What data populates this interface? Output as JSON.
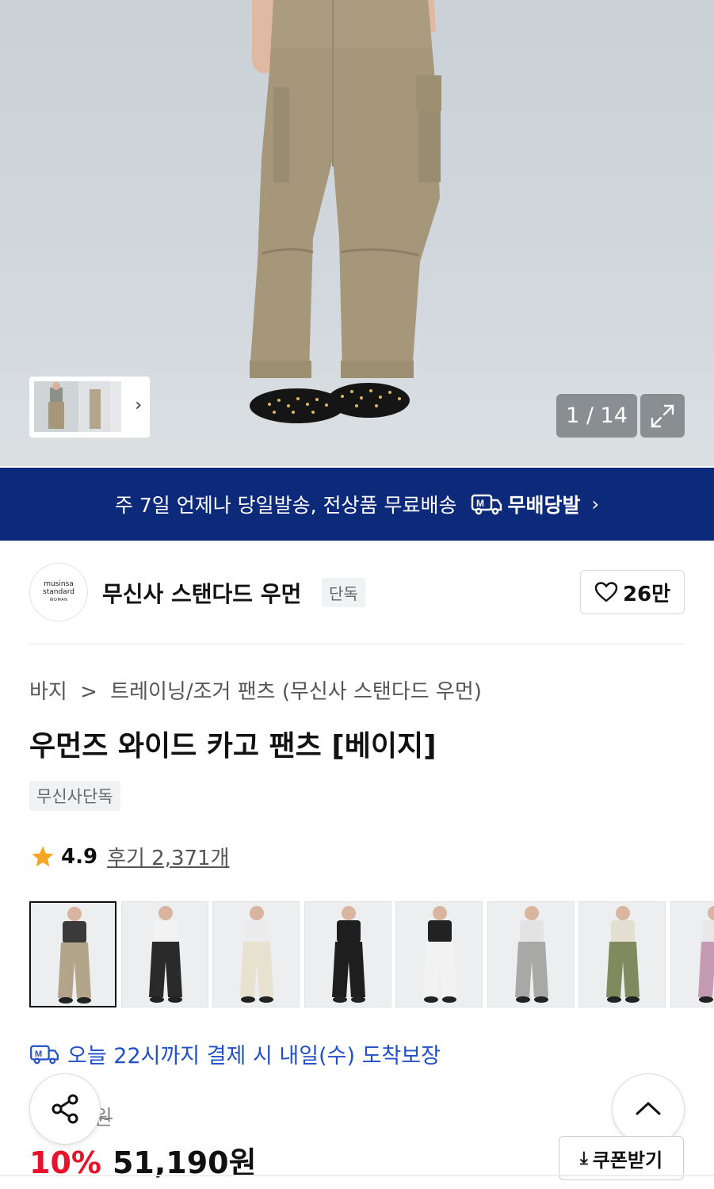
{
  "hero": {
    "counter": "1 / 14",
    "thumb_next_icon": "chevron-right-icon",
    "expand_icon": "expand-icon"
  },
  "banner": {
    "text": "주 7일 언제나 당일발송, 전상품 무료배송",
    "brand": "무배당발",
    "arrow": "›"
  },
  "brand": {
    "logo_line1": "musinsa",
    "logo_line2": "standard",
    "logo_line3": "WOMAN",
    "name": "무신사 스탠다드 우먼",
    "tag": "단독",
    "likes": "26만"
  },
  "breadcrumb": {
    "category": "바지",
    "separator": ">",
    "subcategory": "트레이닝/조거 팬츠 (무신사 스탠다드 우먼)"
  },
  "product": {
    "title": "우먼즈 와이드 카고 팬츠 [베이지]",
    "badge": "무신사단독",
    "rating": "4.9",
    "reviews": "후기 2,371개",
    "delivery": "오늘 22시까지 결제 시 내일(수) 도착보장",
    "original_price": "원",
    "discount": "10%",
    "price": "51,190원"
  },
  "color_options": [
    {
      "name": "beige",
      "pants": "#b3a58a",
      "top": "#3a3a3a",
      "selected": true
    },
    {
      "name": "black",
      "pants": "#2a2a2a",
      "top": "#f2f2f2"
    },
    {
      "name": "ivory",
      "pants": "#e7e2cf",
      "top": "#ececec"
    },
    {
      "name": "black-2",
      "pants": "#1e1e1e",
      "top": "#1e1e1e"
    },
    {
      "name": "white",
      "pants": "#f2f2f2",
      "top": "#222222"
    },
    {
      "name": "gray",
      "pants": "#a8a8a6",
      "top": "#e3e3e3"
    },
    {
      "name": "khaki",
      "pants": "#7f8a5e",
      "top": "#e3dfd2"
    },
    {
      "name": "pink",
      "pants": "#c49bb3",
      "top": "#e8e8e8"
    }
  ],
  "actions": {
    "coupon": "쿠폰받기",
    "coupon_icon": "⤓",
    "share_icon": "share-icon",
    "top_icon": "chevron-up-icon"
  },
  "colors": {
    "banner_bg": "#0d2a7a",
    "discount": "#e8132b",
    "delivery": "#2150c8",
    "star": "#f5a623"
  }
}
